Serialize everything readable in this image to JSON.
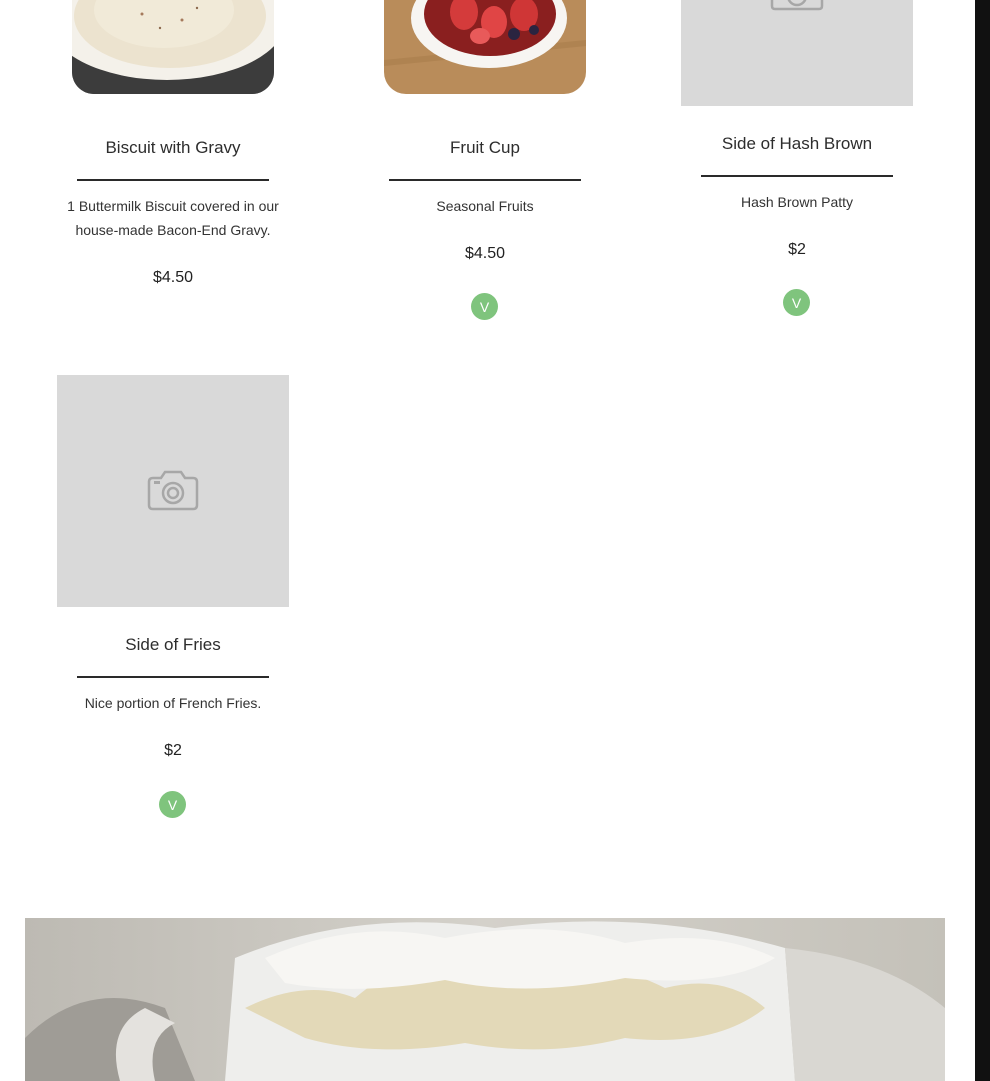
{
  "menu": {
    "items": [
      {
        "title": "Biscuit with Gravy",
        "description": "1 Buttermilk Biscuit covered in our house-made Bacon-End Gravy.",
        "price": "$4.50",
        "badge": null,
        "image": "biscuit-gravy-photo"
      },
      {
        "title": "Fruit Cup",
        "description": "Seasonal Fruits",
        "price": "$4.50",
        "badge": "V",
        "image": "fruit-cup-photo"
      },
      {
        "title": "Side of Hash Brown",
        "description": "Hash Brown Patty",
        "price": "$2",
        "badge": "V",
        "image": "camera-placeholder-icon"
      },
      {
        "title": "Side of Fries",
        "description": "Nice portion of French Fries.",
        "price": "$2",
        "badge": "V",
        "image": "camera-placeholder-icon"
      }
    ]
  },
  "colors": {
    "badge": "#7fc47d",
    "placeholder": "#d9d9d9",
    "rule": "#2a2a2a",
    "scrollbar": "#111111"
  }
}
